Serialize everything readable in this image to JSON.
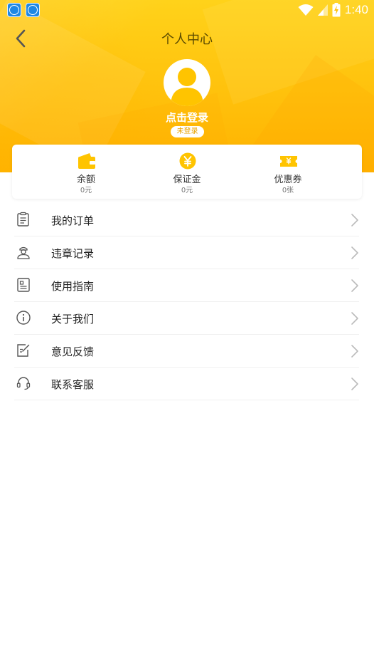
{
  "status_bar": {
    "time": "1:40"
  },
  "header": {
    "title": "个人中心"
  },
  "profile": {
    "login_prompt": "点击登录",
    "login_status": "未登录"
  },
  "stats": [
    {
      "label": "余额",
      "value": "0元",
      "icon": "wallet-icon"
    },
    {
      "label": "保证金",
      "value": "0元",
      "icon": "yuan-coin-icon"
    },
    {
      "label": "优惠券",
      "value": "0张",
      "icon": "coupon-icon"
    }
  ],
  "menu": [
    {
      "label": "我的订单",
      "icon": "clipboard-icon"
    },
    {
      "label": "违章记录",
      "icon": "officer-icon"
    },
    {
      "label": "使用指南",
      "icon": "guide-icon"
    },
    {
      "label": "关于我们",
      "icon": "info-icon"
    },
    {
      "label": "意见反馈",
      "icon": "edit-icon"
    },
    {
      "label": "联系客服",
      "icon": "headset-icon"
    }
  ],
  "colors": {
    "brand_yellow": "#ffc10c",
    "icon_yellow": "#ffc400"
  }
}
